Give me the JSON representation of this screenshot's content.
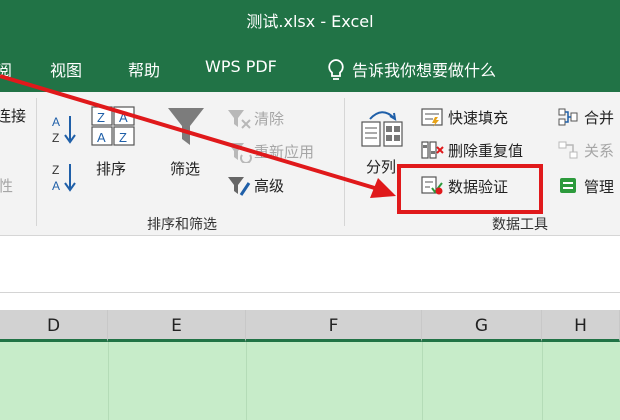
{
  "window": {
    "title": "测试.xlsx  -  Excel"
  },
  "menu": {
    "partial_left": "阅",
    "view": "视图",
    "help": "帮助",
    "wps_pdf": "WPS PDF",
    "tell_me": "告诉我你想要做什么"
  },
  "ribbon": {
    "connections_partial": "连接",
    "partial_left_dim": "性",
    "sort": "排序",
    "filter": "筛选",
    "clear": "清除",
    "reapply": "重新应用",
    "advanced": "高级",
    "sort_filter_group": "排序和筛选",
    "text_to_columns": "分列",
    "flash_fill": "快速填充",
    "remove_duplicates": "删除重复值",
    "data_validation": "数据验证",
    "data_tools_group": "数据工具",
    "consolidate_partial": "合并",
    "relationships_partial": "关系",
    "manage_partial": "管理"
  },
  "columns": [
    "D",
    "E",
    "F",
    "G",
    "H"
  ],
  "colors": {
    "excel_green": "#217346",
    "highlight_red": "#e0191b",
    "selected_cells": "#c7ecc9"
  },
  "icons": [
    "sort-az-icon",
    "sort-za-icon",
    "sort-dialog-icon",
    "funnel-filter-icon",
    "clear-filter-icon",
    "reapply-icon",
    "advanced-filter-icon",
    "text-to-columns-icon",
    "flash-fill-icon",
    "remove-duplicates-icon",
    "data-validation-icon",
    "consolidate-icon",
    "relationships-icon",
    "manage-data-model-icon",
    "lightbulb-icon"
  ]
}
